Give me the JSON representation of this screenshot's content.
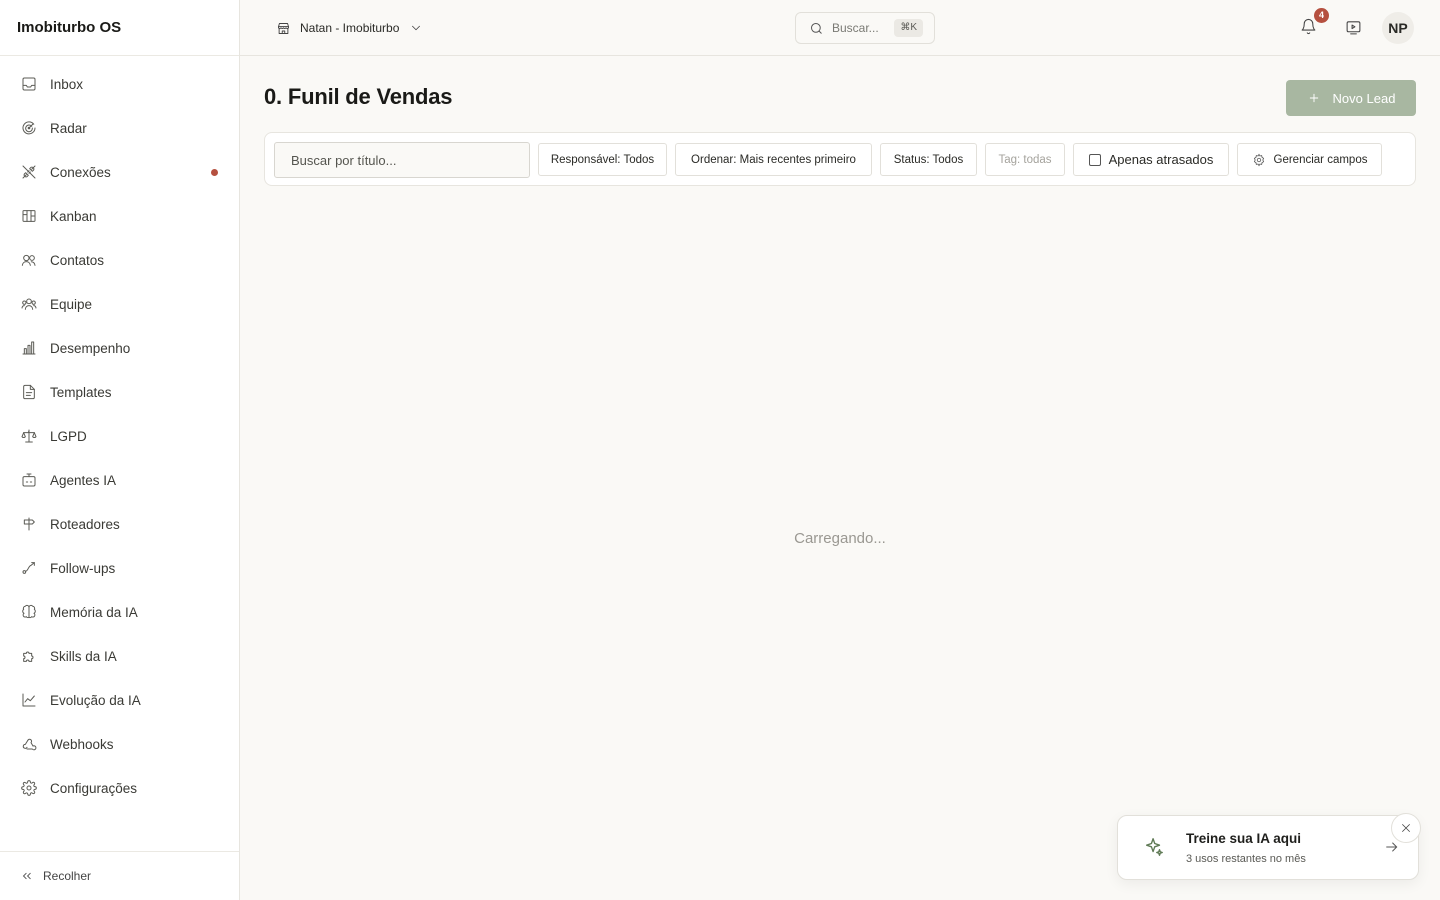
{
  "app": {
    "title": "Imobiturbo OS"
  },
  "sidebar": {
    "items": [
      {
        "label": "Inbox",
        "icon": "inbox-icon"
      },
      {
        "label": "Radar",
        "icon": "radar-icon"
      },
      {
        "label": "Conexões",
        "icon": "plug-icon",
        "alert": true
      },
      {
        "label": "Kanban",
        "icon": "kanban-icon"
      },
      {
        "label": "Contatos",
        "icon": "contacts-icon"
      },
      {
        "label": "Equipe",
        "icon": "team-icon"
      },
      {
        "label": "Desempenho",
        "icon": "bar-chart-icon"
      },
      {
        "label": "Templates",
        "icon": "file-text-icon"
      },
      {
        "label": "LGPD",
        "icon": "scale-icon"
      },
      {
        "label": "Agentes IA",
        "icon": "bot-icon"
      },
      {
        "label": "Roteadores",
        "icon": "signpost-icon"
      },
      {
        "label": "Follow-ups",
        "icon": "route-icon"
      },
      {
        "label": "Memória da IA",
        "icon": "brain-icon"
      },
      {
        "label": "Skills da IA",
        "icon": "puzzle-icon"
      },
      {
        "label": "Evolução da IA",
        "icon": "line-chart-icon"
      },
      {
        "label": "Webhooks",
        "icon": "webhook-icon"
      },
      {
        "label": "Configurações",
        "icon": "gear-icon"
      }
    ],
    "collapse_label": "Recolher",
    "alert_color": "#b5503f"
  },
  "topbar": {
    "workspace": "Natan - Imobiturbo",
    "search_label": "Buscar...",
    "search_shortcut": "⌘K",
    "notifications_count": "4",
    "avatar_initials": "NP"
  },
  "main": {
    "title": "0. Funil de Vendas",
    "new_lead_label": "Novo Lead",
    "accent_color": "#a8b7a1",
    "filters": {
      "search_placeholder": "Buscar por título...",
      "responsavel": "Responsável: Todos",
      "ordenar": "Ordenar: Mais recentes primeiro",
      "status": "Status: Todos",
      "tag": "Tag: todas",
      "atrasados": "Apenas atrasados",
      "atrasados_checked": false,
      "gerenciar": "Gerenciar campos"
    },
    "loading_text": "Carregando..."
  },
  "toast": {
    "title": "Treine sua IA aqui",
    "subtitle": "3 usos restantes no mês"
  }
}
